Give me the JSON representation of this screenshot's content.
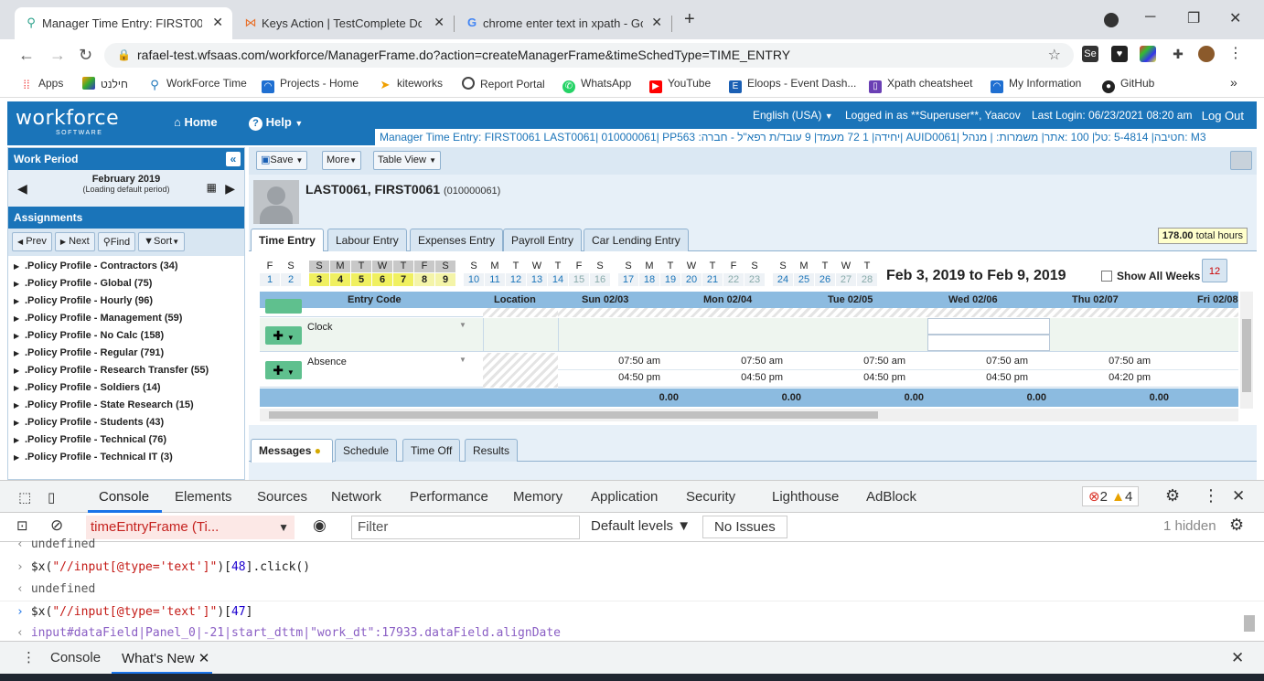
{
  "browser": {
    "tabs": [
      {
        "title": "Manager Time Entry: FIRST0061 L",
        "close": "✕"
      },
      {
        "title": "Keys Action | TestComplete Docu",
        "close": "✕"
      },
      {
        "title": "chrome enter text in xpath - Goo",
        "close": "✕"
      }
    ],
    "new_tab": "+",
    "url": "rafael-test.wfsaas.com/workforce/ManagerFrame.do?action=createManagerFrame&timeSchedType=TIME_ENTRY",
    "bookmarks": [
      "Apps",
      "חילנט",
      "WorkForce Time",
      "Projects - Home",
      "kiteworks",
      "Report Portal",
      "WhatsApp",
      "YouTube",
      "Eloops - Event Dash...",
      "Xpath cheatsheet",
      "My Information",
      "GitHub"
    ],
    "more_bookmarks": "»"
  },
  "app": {
    "logo": "workforce",
    "logo_sub": "SOFTWARE",
    "nav_home": "Home",
    "nav_help": "Help",
    "language": "English (USA)",
    "logged_in": "Logged in as **Superuser**, Yaacov",
    "last_login": "Last Login: 06/23/2021 08:20 am",
    "logout": "Log Out",
    "info_bar": "Manager Time Entry: FIRST0061 LAST0061| 010000061| PP563 :יחידה| 1 72 מעמד| 9 עובד/ת רפא\"ל - חברה| AUID0061| חטיבה| 5-4814 :טל| 100 :אתר| משמרות: | מנהל: M3"
  },
  "left": {
    "work_period_title": "Work Period",
    "collapse": "«",
    "month": "February 2019",
    "loading": "(Loading default period)",
    "assignments_title": "Assignments",
    "tools": [
      "Prev",
      "Next",
      "Find",
      "Sort"
    ],
    "profiles": [
      ".Policy Profile - Contractors (34)",
      ".Policy Profile - Global (75)",
      ".Policy Profile - Hourly (96)",
      ".Policy Profile - Management (59)",
      ".Policy Profile - No Calc (158)",
      ".Policy Profile - Regular (791)",
      ".Policy Profile - Research Transfer (55)",
      ".Policy Profile - Soldiers (14)",
      ".Policy Profile - State Research (15)",
      ".Policy Profile - Students (43)",
      ".Policy Profile - Technical (76)",
      ".Policy Profile - Technical IT (3)"
    ]
  },
  "main": {
    "toolbar": {
      "save": "Save",
      "more": "More",
      "table_view": "Table View"
    },
    "employee_name": "LAST0061, FIRST0061",
    "employee_id": "(010000061)",
    "tabs": [
      "Time Entry",
      "Labour Entry",
      "Expenses Entry",
      "Payroll Entry",
      "Car Lending Entry"
    ],
    "total_hours_value": "178.00",
    "total_hours_label": "total hours",
    "date_range": "Feb 3, 2019 to Feb 9, 2019",
    "show_all_weeks": "Show All Weeks",
    "calendar_icon_day": "12",
    "cal_days": [
      "F",
      "S",
      "S",
      "M",
      "T",
      "W",
      "T",
      "F",
      "S",
      "S",
      "M",
      "T",
      "W",
      "T",
      "F",
      "S",
      "S",
      "M",
      "T",
      "W",
      "T",
      "F",
      "S",
      "S",
      "M",
      "T",
      "W",
      "T"
    ],
    "cal_nums": [
      "1",
      "2",
      "3",
      "4",
      "5",
      "6",
      "7",
      "8",
      "9",
      "10",
      "11",
      "12",
      "13",
      "14",
      "15",
      "16",
      "17",
      "18",
      "19",
      "20",
      "21",
      "22",
      "23",
      "24",
      "25",
      "26",
      "27",
      "28"
    ],
    "grid_headers": [
      "Entry Code",
      "Location",
      "Sun 02/03",
      "Mon 02/04",
      "Tue 02/05",
      "Wed 02/06",
      "Thu 02/07",
      "Fri 02/08"
    ],
    "rows": [
      {
        "label": "Clock"
      },
      {
        "label": "Absence",
        "in": [
          "07:50 am",
          "07:50 am",
          "07:50 am",
          "07:50 am",
          "07:50 am"
        ],
        "out": [
          "04:50 pm",
          "04:50 pm",
          "04:50 pm",
          "04:50 pm",
          "04:20 pm"
        ]
      }
    ],
    "totals": [
      "0.00",
      "0.00",
      "0.00",
      "0.00",
      "0.00"
    ],
    "bottom_tabs": [
      "Messages",
      "Schedule",
      "Time Off",
      "Results"
    ]
  },
  "devtools": {
    "tabs": [
      "Console",
      "Elements",
      "Sources",
      "Network",
      "Performance",
      "Memory",
      "Application",
      "Security",
      "Lighthouse",
      "AdBlock"
    ],
    "errors": "2",
    "warnings": "4",
    "context": "timeEntryFrame (Ti...",
    "filter_placeholder": "Filter",
    "levels": "Default levels ▼",
    "issues": "No Issues",
    "hidden": "1 hidden",
    "lines": [
      {
        "kind": "out",
        "text": "undefined"
      },
      {
        "kind": "in",
        "pre": "$x(",
        "str": "\"//input[@type='text']\"",
        "mid": ")[",
        "num": "48",
        "post": "].click()"
      },
      {
        "kind": "out",
        "text": "undefined"
      },
      {
        "kind": "in",
        "pre": "$x(",
        "str": "\"//input[@type='text']\"",
        "mid": ")[",
        "num": "47",
        "post": "]"
      },
      {
        "kind": "res",
        "text": "input#dataField|Panel_0|-21|start_dttm|\"work_dt\":17933.dataField.alignDate"
      }
    ],
    "drawer_tabs": [
      "Console",
      "What's New"
    ]
  }
}
